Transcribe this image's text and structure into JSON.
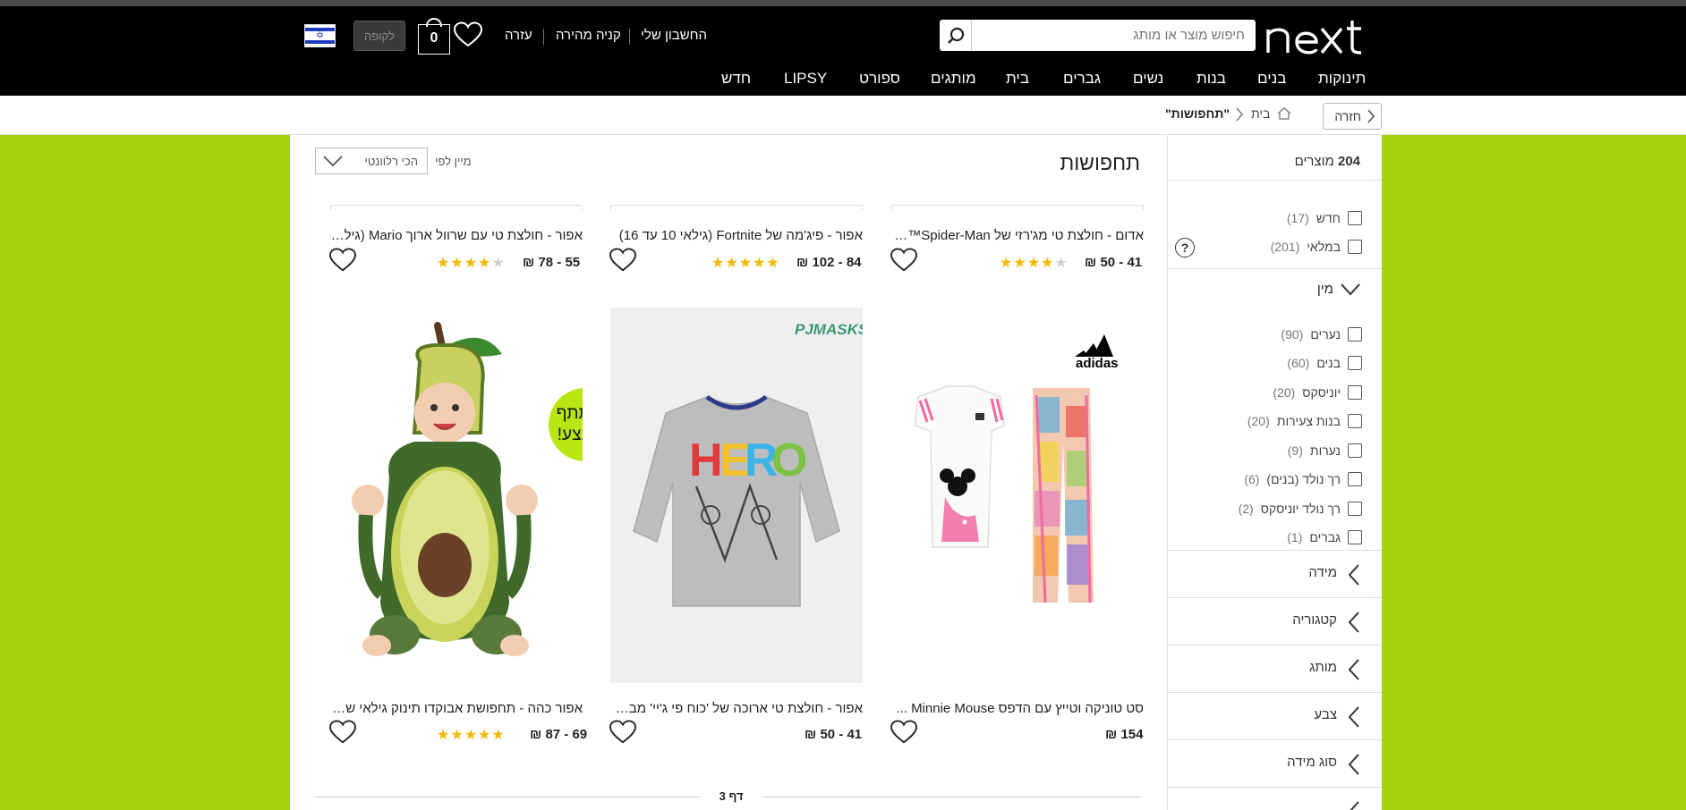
{
  "header": {
    "logo_text": "next",
    "search_placeholder": "חיפוש מוצר או מותג",
    "my_account": "החשבון שלי",
    "quick_buy": "קניה מהירה",
    "help": "עזרה",
    "bag_count": "0",
    "checkout": "לקופה",
    "flag": "israel-flag"
  },
  "nav": [
    "תינוקות",
    "בנים",
    "בנות",
    "נשים",
    "גברים",
    "בית",
    "מותגים",
    "ספורט",
    "LIPSY",
    "חדש"
  ],
  "breadcrumb": {
    "back": "חזרה",
    "home_icon": "home-icon",
    "home": "בית",
    "current": "\"תחפושות\""
  },
  "sidebar": {
    "count_number": "204",
    "count_label": "מוצרים",
    "availability": [
      {
        "label": "חדש",
        "count": "(17)"
      },
      {
        "label": "במלאי",
        "count": "(201)"
      }
    ],
    "gender_title": "מין",
    "gender": [
      {
        "label": "נערים",
        "count": "(90)"
      },
      {
        "label": "בנים",
        "count": "(60)"
      },
      {
        "label": "יוניסקס",
        "count": "(20)"
      },
      {
        "label": "בנות צעירות",
        "count": "(20)"
      },
      {
        "label": "נערות",
        "count": "(9)"
      },
      {
        "label": "רך נולד (בנים)",
        "count": "(6)"
      },
      {
        "label": "רך נולד יוניסקס",
        "count": "(2)"
      },
      {
        "label": "גברים",
        "count": "(1)"
      }
    ],
    "facets": [
      "מידה",
      "קטגוריה",
      "מותג",
      "צבע",
      "סוג מידה"
    ]
  },
  "content": {
    "title": "תחפושות",
    "sort_label": "מיין לפי",
    "sort_value": "הכי רלוונטי",
    "top_products": [
      {
        "name": "אדום - חולצת טי מג'רזי של Spider-Man™ ע...",
        "price": "41 - 50 ₪",
        "rating": 4.5
      },
      {
        "name": "אפור - פיג'מה של Fortnite (גילאי 10 עד 16)",
        "price": "84 - 102 ₪",
        "rating": 5
      },
      {
        "name": "אפור - חולצת טי עם שרוול ארוך Mario (גילאי...",
        "price": "55 - 78 ₪",
        "rating": 4.5
      }
    ],
    "products": [
      {
        "name": "סט טוניקה וטייץ עם הדפס Minnie Mouse ...",
        "price": "154 ₪",
        "brand": "adidas",
        "image": "adidas-minnie-set"
      },
      {
        "name": "אפור - חולצת טי ארוכה של 'כוח פי ג'יי' מבד ג'...",
        "price": "41 - 50 ₪",
        "rating": 0,
        "brand": "PJ MASKS",
        "image": "pj-masks-hero-shirt"
      },
      {
        "name": "אפור כהה - תחפושת אבוקדו תינוק גילאי שנה-2",
        "price": "69 - 87 ₪",
        "rating": 5,
        "badge": "משתתף במבצע!",
        "image": "avocado-baby-costume"
      }
    ],
    "page_label": "דף 3"
  },
  "colors": {
    "header_bg": "#000000",
    "page_bg": "#a3d40a",
    "star": "#f5b800",
    "promo_badge": "#b8e613"
  }
}
